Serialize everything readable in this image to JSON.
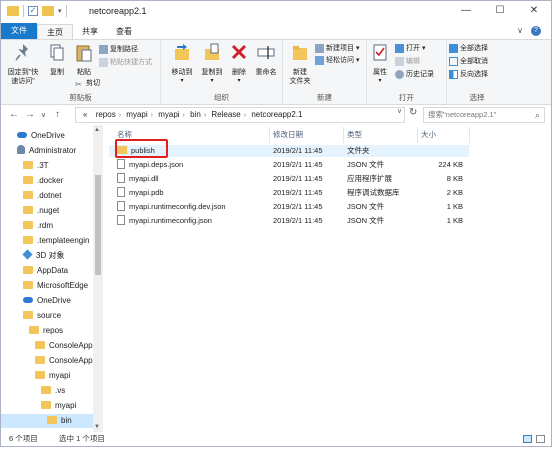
{
  "window": {
    "title": "netcoreapp2.1",
    "minimize": "—",
    "maximize": "☐",
    "close": "✕"
  },
  "ribbon_tabs": [
    "文件",
    "主页",
    "共享",
    "查看"
  ],
  "ribbon": {
    "clipboard": {
      "pin": "固定到\"快速访问\"",
      "copy": "复制",
      "paste": "粘贴",
      "copy_path": "复制路径",
      "paste_shortcut": "粘贴快捷方式",
      "cut": "剪切",
      "label": "剪贴板"
    },
    "organize": {
      "move_to": "移动到",
      "copy_to": "复制到",
      "delete": "删除",
      "rename": "重命名",
      "label": "组织"
    },
    "new": {
      "new_folder": "新建\n文件夹",
      "new_item": "新建项目",
      "easy_access": "轻松访问",
      "label": "新建"
    },
    "open": {
      "properties": "属性",
      "open": "打开",
      "edit": "编辑",
      "history": "历史记录",
      "label": "打开"
    },
    "select": {
      "select_all": "全部选择",
      "select_none": "全部取消",
      "invert": "反向选择",
      "label": "选择"
    }
  },
  "nav": {
    "back": "←",
    "forward": "→",
    "recent": "∨",
    "up": "↑",
    "breadcrumb": [
      "«",
      "repos",
      "myapi",
      "myapi",
      "bin",
      "Release",
      "netcoreapp2.1"
    ],
    "search_placeholder": "搜索\"netcoreapp2.1\""
  },
  "tree": [
    {
      "label": "OneDrive",
      "icon": "onedrive-icon",
      "indent": 0
    },
    {
      "label": "Administrator",
      "icon": "user-icon",
      "indent": 0
    },
    {
      "label": ".3T",
      "icon": "folder-icon",
      "indent": 1
    },
    {
      "label": ".docker",
      "icon": "folder-icon",
      "indent": 1
    },
    {
      "label": ".dotnet",
      "icon": "folder-icon",
      "indent": 1
    },
    {
      "label": ".nuget",
      "icon": "folder-icon",
      "indent": 1
    },
    {
      "label": ".rdm",
      "icon": "folder-icon",
      "indent": 1
    },
    {
      "label": ".templateengin",
      "icon": "folder-icon",
      "indent": 1
    },
    {
      "label": "3D 对象",
      "icon": "3d-objects-icon",
      "indent": 1
    },
    {
      "label": "AppData",
      "icon": "folder-icon",
      "indent": 1
    },
    {
      "label": "MicrosoftEdge",
      "icon": "folder-icon",
      "indent": 1
    },
    {
      "label": "OneDrive",
      "icon": "onedrive-icon",
      "indent": 1
    },
    {
      "label": "source",
      "icon": "folder-icon",
      "indent": 1
    },
    {
      "label": "repos",
      "icon": "folder-icon",
      "indent": 2
    },
    {
      "label": "ConsoleApp",
      "icon": "folder-icon",
      "indent": 3
    },
    {
      "label": "ConsoleApp",
      "icon": "folder-icon",
      "indent": 3
    },
    {
      "label": "myapi",
      "icon": "folder-icon",
      "indent": 3
    },
    {
      "label": ".vs",
      "icon": "folder-icon",
      "indent": 4
    },
    {
      "label": "myapi",
      "icon": "folder-icon",
      "indent": 4
    },
    {
      "label": "bin",
      "icon": "folder-icon",
      "indent": 5,
      "selected": true
    }
  ],
  "columns": {
    "name": "名称",
    "date": "修改日期",
    "type": "类型",
    "size": "大小"
  },
  "files": [
    {
      "name": "publish",
      "date": "2019/2/1 11:45",
      "type": "文件夹",
      "size": "",
      "icon": "folder-icon",
      "selected": true
    },
    {
      "name": "myapi.deps.json",
      "date": "2019/2/1 11:45",
      "type": "JSON 文件",
      "size": "224 KB",
      "icon": "json-file-icon"
    },
    {
      "name": "myapi.dll",
      "date": "2019/2/1 11:45",
      "type": "应用程序扩展",
      "size": "8 KB",
      "icon": "dll-file-icon"
    },
    {
      "name": "myapi.pdb",
      "date": "2019/2/1 11:45",
      "type": "程序调试数据库",
      "size": "2 KB",
      "icon": "pdb-file-icon"
    },
    {
      "name": "myapi.runtimeconfig.dev.json",
      "date": "2019/2/1 11:45",
      "type": "JSON 文件",
      "size": "1 KB",
      "icon": "json-file-icon"
    },
    {
      "name": "myapi.runtimeconfig.json",
      "date": "2019/2/1 11:45",
      "type": "JSON 文件",
      "size": "1 KB",
      "icon": "json-file-icon"
    }
  ],
  "status": {
    "count": "6 个项目",
    "selected": "选中 1 个项目"
  },
  "colors": {
    "file_tab": "#1979ca",
    "selection": "#cce8ff",
    "folder": "#f2c65a",
    "highlight_box": "#e02020"
  }
}
